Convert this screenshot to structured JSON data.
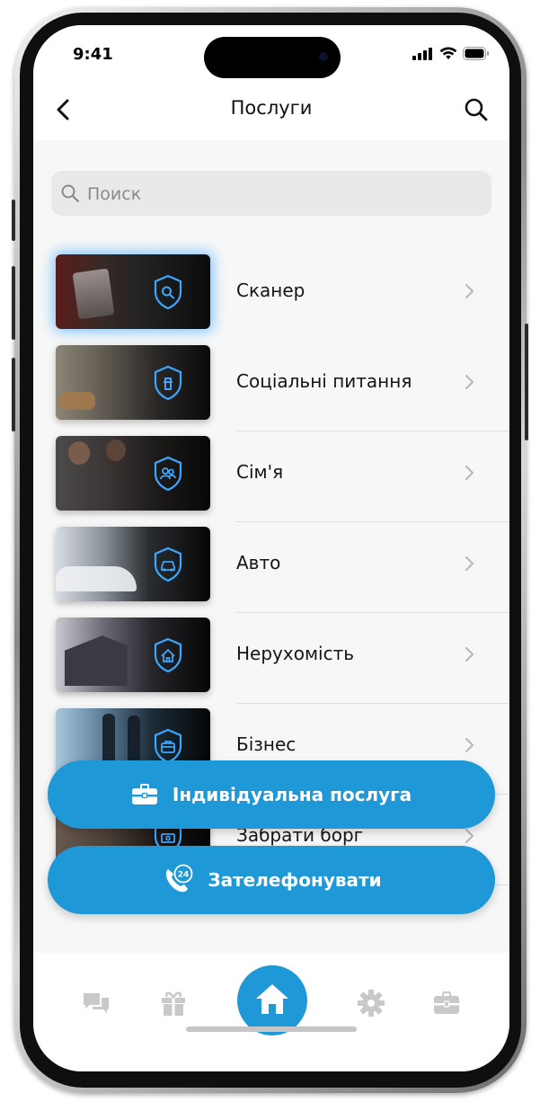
{
  "status": {
    "time": "9:41"
  },
  "header": {
    "title": "Послуги"
  },
  "search": {
    "placeholder": "Поиск"
  },
  "services": [
    {
      "label": "Сканер",
      "icon": "search-doc-icon",
      "theme": "dark-red"
    },
    {
      "label": "Соціальні питання",
      "icon": "fire-hydrant-icon",
      "theme": "room"
    },
    {
      "label": "Сім'я",
      "icon": "people-icon",
      "theme": "couple"
    },
    {
      "label": "Авто",
      "icon": "car-icon",
      "theme": "car"
    },
    {
      "label": "Нерухомість",
      "icon": "house-icon",
      "theme": "building"
    },
    {
      "label": "Бізнес",
      "icon": "briefcase-icon",
      "theme": "office"
    },
    {
      "label": "Забрати борг",
      "icon": "money-icon",
      "theme": "people"
    }
  ],
  "actions": {
    "individual_label": "Індивідуальна послуга",
    "call_label": "Зателефонувати",
    "call_badge": "24"
  },
  "colors": {
    "accent": "#1f98d8",
    "icon_inactive": "#c9c9c9",
    "shield": "#3ba7ff"
  },
  "tabs": [
    {
      "icon": "chat-icon"
    },
    {
      "icon": "gift-icon"
    },
    {
      "icon": "home-icon",
      "active": true
    },
    {
      "icon": "gear-icon"
    },
    {
      "icon": "briefcase-icon"
    }
  ]
}
